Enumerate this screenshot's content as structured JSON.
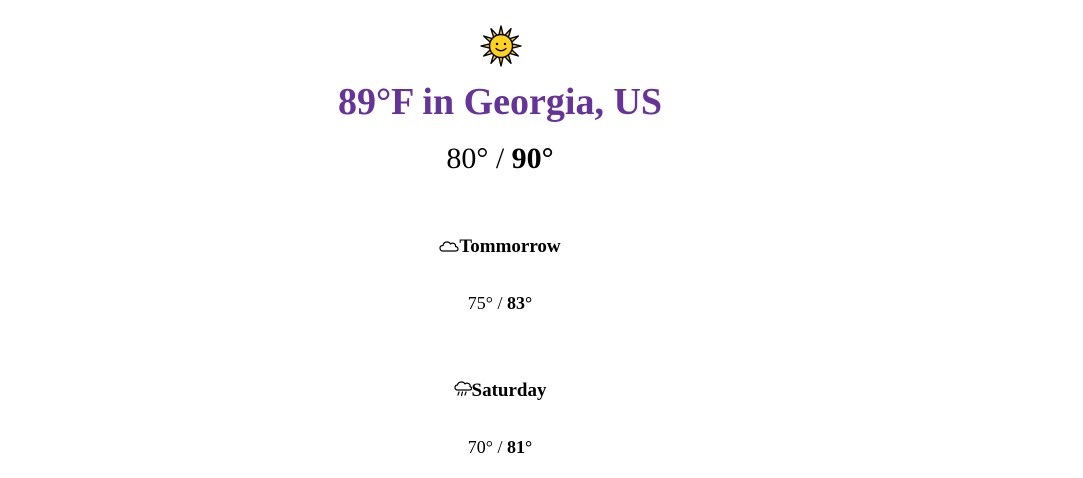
{
  "current": {
    "icon": "sun-with-face-icon",
    "title": "89°F in Georgia, US",
    "low": "80°",
    "separator": " / ",
    "high": "90°"
  },
  "forecast": [
    {
      "icon": "cloud-icon",
      "label": "Tommorrow",
      "low": "75°",
      "separator": " / ",
      "high": "83°"
    },
    {
      "icon": "cloud-with-rain-icon",
      "label": "Saturday",
      "low": "70°",
      "separator": " / ",
      "high": "81°"
    }
  ],
  "colors": {
    "title": "#663399",
    "sun": "#FFD21E",
    "sun_outline": "#000000"
  }
}
